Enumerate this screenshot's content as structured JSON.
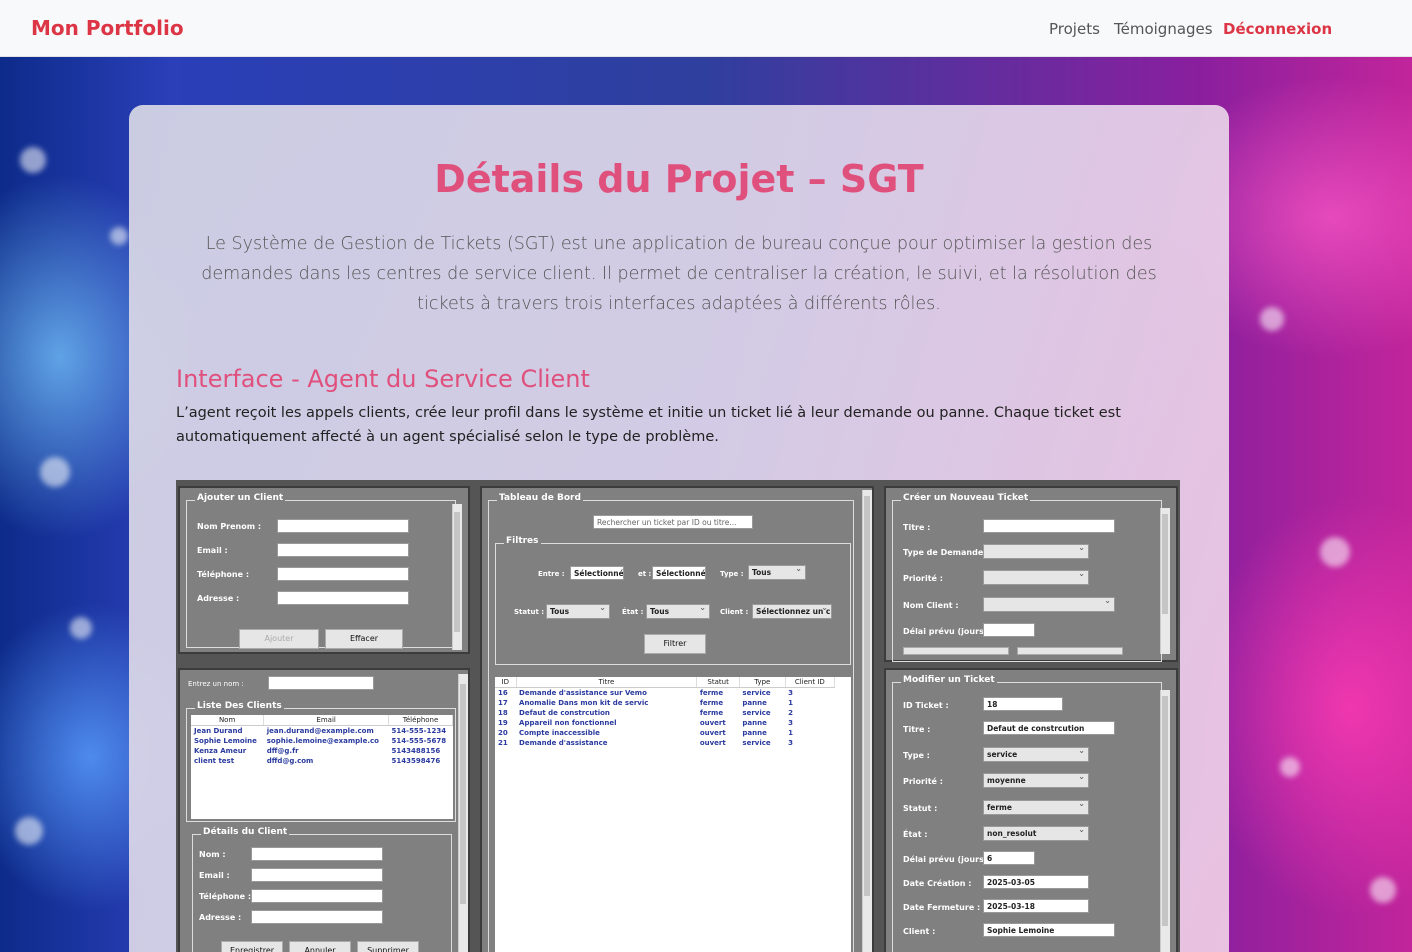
{
  "nav": {
    "brand": "Mon Portfolio",
    "links": [
      "Projets",
      "Témoignages",
      "Déconnexion"
    ]
  },
  "page": {
    "title": "Détails du Projet – SGT",
    "intro": "Le Système de Gestion de Tickets (SGT) est une application de bureau conçue pour optimiser la gestion des demandes dans les centres de service client. Il permet de centraliser la création, le suivi, et la résolution des tickets à travers trois interfaces adaptées à différents rôles.",
    "section_title": "Interface - Agent du Service Client",
    "section_text": "L’agent reçoit les appels clients, crée leur profil dans le système et initie un ticket lié à leur demande ou panne. Chaque ticket est automatiquement affecté à un agent spécialisé selon le type de problème."
  },
  "colors": {
    "accent": "#dc3545",
    "heading": "#e0507d"
  },
  "app": {
    "add_client": {
      "title": "Ajouter un Client",
      "labels": [
        "Nom Prenom :",
        "Email :",
        "Téléphone :",
        "Adresse :"
      ],
      "btn_add": "Ajouter",
      "btn_clear": "Effacer"
    },
    "client_search": {
      "label": "Entrez un nom :"
    },
    "client_list": {
      "title": "Liste Des Clients",
      "headers": [
        "Nom",
        "Email",
        "Téléphone"
      ],
      "rows": [
        [
          "Jean Durand",
          "jean.durand@example.com",
          "514-555-1234"
        ],
        [
          "Sophie Lemoine",
          "sophie.lemoine@example.co",
          "514-555-5678"
        ],
        [
          "Kenza Ameur",
          "dff@g.fr",
          "5143488156"
        ],
        [
          "client test",
          "dffd@g.com",
          "5143598476"
        ]
      ]
    },
    "client_details": {
      "title": "Détails du Client",
      "labels": [
        "Nom :",
        "Email :",
        "Téléphone :",
        "Adresse :"
      ],
      "buttons": [
        "Enregistrer",
        "Annuler",
        "Supprimer"
      ]
    },
    "dashboard": {
      "title": "Tableau de Bord",
      "search_placeholder": "Rechercher un ticket par ID ou titre...",
      "filters_title": "Filtres",
      "entre": "Entre :",
      "et": "et :",
      "type": "Type :",
      "statut": "Statut :",
      "etat": "État :",
      "client": "Client :",
      "date1": "Sélectionné",
      "date2": "Sélectionné",
      "type_val": "Tous",
      "statut_val": "Tous",
      "etat_val": "Tous",
      "client_val": "Sélectionnez un cli",
      "filter_btn": "Filtrer",
      "headers": [
        "ID",
        "Titre",
        "Statut",
        "Type",
        "Client ID"
      ],
      "rows": [
        [
          "16",
          "Demande d'assistance sur Vemo",
          "ferme",
          "service",
          "3"
        ],
        [
          "17",
          "Anomalie Dans mon kit de servic",
          "ferme",
          "panne",
          "1"
        ],
        [
          "18",
          "Defaut de constrcution",
          "ferme",
          "service",
          "2"
        ],
        [
          "19",
          "Appareil non fonctionnel",
          "ouvert",
          "panne",
          "3"
        ],
        [
          "20",
          "Compte inaccessible",
          "ouvert",
          "panne",
          "1"
        ],
        [
          "21",
          "Demande d'assistance",
          "ouvert",
          "service",
          "3"
        ]
      ]
    },
    "new_ticket": {
      "title": "Créer un Nouveau Ticket",
      "labels": [
        "Titre :",
        "Type de Demande :",
        "Priorité :",
        "Nom Client :",
        "Délai prévu (jours) :"
      ]
    },
    "edit_ticket": {
      "title": "Modifier un Ticket",
      "labels": [
        "ID Ticket :",
        "Titre :",
        "Type :",
        "Priorité :",
        "Statut :",
        "État :",
        "Délai prévu (jours) :",
        "Date Création :",
        "Date Fermeture :",
        "Client :"
      ],
      "values": [
        "18",
        "Defaut de constrcution",
        "service",
        "moyenne",
        "ferme",
        "non_resolut",
        "6",
        "2025-03-05",
        "2025-03-18",
        "Sophie Lemoine"
      ]
    }
  }
}
